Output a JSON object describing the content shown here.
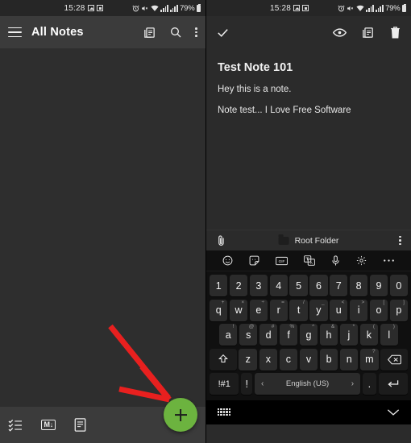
{
  "status_bar": {
    "time": "15:28",
    "battery": "79%",
    "icons": [
      "photo-icon",
      "sim-icon",
      "alarm-icon",
      "mute-icon",
      "wifi-icon",
      "signal-icon",
      "signal2-icon",
      "battery-icon"
    ]
  },
  "left_screen": {
    "appbar": {
      "menu_icon": "hamburger-icon",
      "title": "All Notes",
      "actions": [
        "view-mode-icon",
        "search-icon",
        "overflow-icon"
      ]
    },
    "list": {
      "empty": true,
      "items": []
    },
    "bottom_bar": {
      "items": [
        {
          "name": "checklist-icon",
          "label": ""
        },
        {
          "name": "markdown-icon",
          "label": "M"
        },
        {
          "name": "note-icon",
          "label": ""
        }
      ],
      "fab_label": "+",
      "fab_color": "#6cb33f"
    },
    "annotation": {
      "type": "arrow",
      "color": "#e8201f",
      "points_to": "add-note-fab"
    }
  },
  "right_screen": {
    "appbar": {
      "confirm_icon": "check-icon",
      "actions": [
        "eye-preview-icon",
        "view-mode-icon",
        "delete-icon"
      ]
    },
    "note": {
      "title": "Test Note 101",
      "lines": [
        "Hey this is a note.",
        "Note test... I Love Free Software"
      ],
      "cursor_handle_color": "#5fbb77"
    },
    "folder_bar": {
      "attach_icon": "paperclip-icon",
      "folder_icon": "folder-icon",
      "folder_name": "Root Folder",
      "overflow_icon": "overflow-icon"
    },
    "keyboard": {
      "toolbar_icons": [
        "emoji-icon",
        "sticker-icon",
        "gif-icon",
        "translate-icon",
        "mic-icon",
        "settings-icon",
        "more-icon"
      ],
      "row_numbers": [
        {
          "key": "1"
        },
        {
          "key": "2"
        },
        {
          "key": "3"
        },
        {
          "key": "4"
        },
        {
          "key": "5"
        },
        {
          "key": "6"
        },
        {
          "key": "7"
        },
        {
          "key": "8"
        },
        {
          "key": "9"
        },
        {
          "key": "0"
        }
      ],
      "row_top": [
        {
          "key": "q",
          "sup": "+"
        },
        {
          "key": "w",
          "sup": "×"
        },
        {
          "key": "e",
          "sup": "÷"
        },
        {
          "key": "r",
          "sup": "="
        },
        {
          "key": "t",
          "sup": "/"
        },
        {
          "key": "y",
          "sup": "_"
        },
        {
          "key": "u",
          "sup": "<"
        },
        {
          "key": "i",
          "sup": ">"
        },
        {
          "key": "o",
          "sup": "["
        },
        {
          "key": "p",
          "sup": "]"
        }
      ],
      "row_home": [
        {
          "key": "a",
          "sup": "!"
        },
        {
          "key": "s",
          "sup": "@"
        },
        {
          "key": "d",
          "sup": "#"
        },
        {
          "key": "f",
          "sup": "%"
        },
        {
          "key": "g",
          "sup": "^"
        },
        {
          "key": "h",
          "sup": "&"
        },
        {
          "key": "j",
          "sup": "*"
        },
        {
          "key": "k",
          "sup": "("
        },
        {
          "key": "l",
          "sup": ")"
        }
      ],
      "row_bottom": [
        {
          "key": "z",
          "sup": ""
        },
        {
          "key": "x",
          "sup": ""
        },
        {
          "key": "c",
          "sup": ""
        },
        {
          "key": "v",
          "sup": ""
        },
        {
          "key": "b",
          "sup": ""
        },
        {
          "key": "n",
          "sup": ""
        },
        {
          "key": "m",
          "sup": "?"
        }
      ],
      "shift_icon": "shift-icon",
      "backspace_icon": "backspace-icon",
      "symbols_key": "!#1",
      "exclaim_key": "!",
      "space_label": "English (US)",
      "space_prev": "‹",
      "space_next": "›",
      "period_key": ".",
      "enter_icon": "enter-icon"
    },
    "navbar": {
      "keyboard_icon": "keyboard-icon",
      "hide_icon": "chevron-down-icon"
    }
  }
}
